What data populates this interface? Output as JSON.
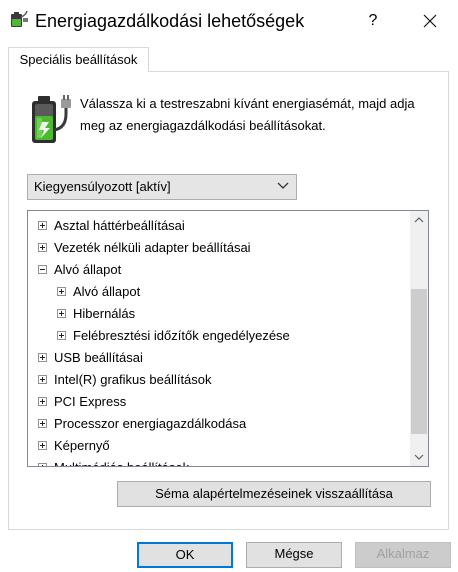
{
  "window": {
    "title": "Energiagazdálkodási lehetőségek",
    "help_label": "?"
  },
  "tab": {
    "label": "Speciális beállítások"
  },
  "description": "Válassza ki a testreszabni kívánt energiasémát, majd adja meg az energiagazdálkodási beállításokat.",
  "scheme": {
    "selected": "Kiegyensúlyozott [aktív]"
  },
  "tree": {
    "items": [
      {
        "label": "Asztal háttérbeállításai",
        "level": 0,
        "expanded": false
      },
      {
        "label": "Vezeték nélküli adapter beállításai",
        "level": 0,
        "expanded": false
      },
      {
        "label": "Alvó állapot",
        "level": 0,
        "expanded": true
      },
      {
        "label": "Alvó állapot",
        "level": 1,
        "expanded": false
      },
      {
        "label": "Hibernálás",
        "level": 1,
        "expanded": false
      },
      {
        "label": "Felébresztési időzítők engedélyezése",
        "level": 1,
        "expanded": false
      },
      {
        "label": "USB beállításai",
        "level": 0,
        "expanded": false
      },
      {
        "label": "Intel(R) grafikus beállítások",
        "level": 0,
        "expanded": false
      },
      {
        "label": "PCI Express",
        "level": 0,
        "expanded": false
      },
      {
        "label": "Processzor energiagazdálkodása",
        "level": 0,
        "expanded": false
      },
      {
        "label": "Képernyő",
        "level": 0,
        "expanded": false
      },
      {
        "label": "Multimédiás beállítások",
        "level": 0,
        "expanded": false
      }
    ]
  },
  "restore_button": "Séma alapértelmezéseinek visszaállítása",
  "buttons": {
    "ok": "OK",
    "cancel": "Mégse",
    "apply": "Alkalmaz"
  },
  "icons": {
    "app": "power-plug-icon",
    "battery": "battery-plug-icon",
    "close": "close-icon",
    "dropdown": "chevron-down-icon"
  },
  "colors": {
    "accent": "#0078d7",
    "battery_green": "#4cba2f"
  }
}
